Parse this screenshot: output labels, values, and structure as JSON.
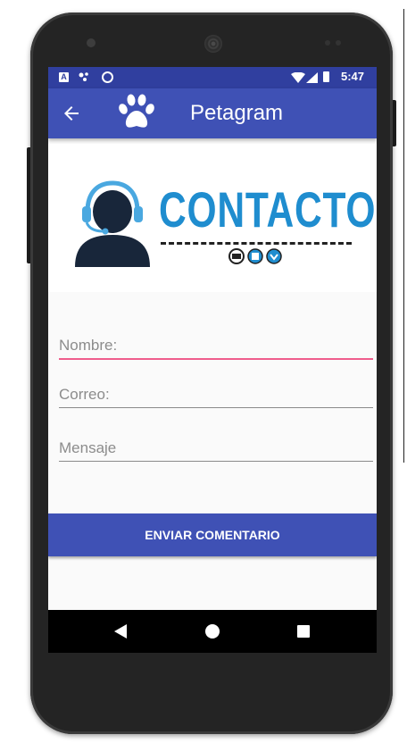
{
  "status_bar": {
    "time": "5:47"
  },
  "app_bar": {
    "title": "Petagram"
  },
  "banner": {
    "heading": "CONTACTO"
  },
  "form": {
    "name_placeholder": "Nombre:",
    "email_placeholder": "Correo:",
    "message_placeholder": "Mensaje"
  },
  "actions": {
    "send_label": "ENVIAR COMENTARIO"
  },
  "icons": {
    "back": "arrow-left-icon",
    "logo": "paw-icon",
    "agent": "headset-agent-icon",
    "nav": [
      "triangle-back-icon",
      "circle-home-icon",
      "square-recent-icon"
    ]
  },
  "colors": {
    "primary": "#3f51b5",
    "primary_dark": "#303f9f",
    "accent": "#ef5d8c",
    "contacto_blue": "#1f8dcf"
  }
}
